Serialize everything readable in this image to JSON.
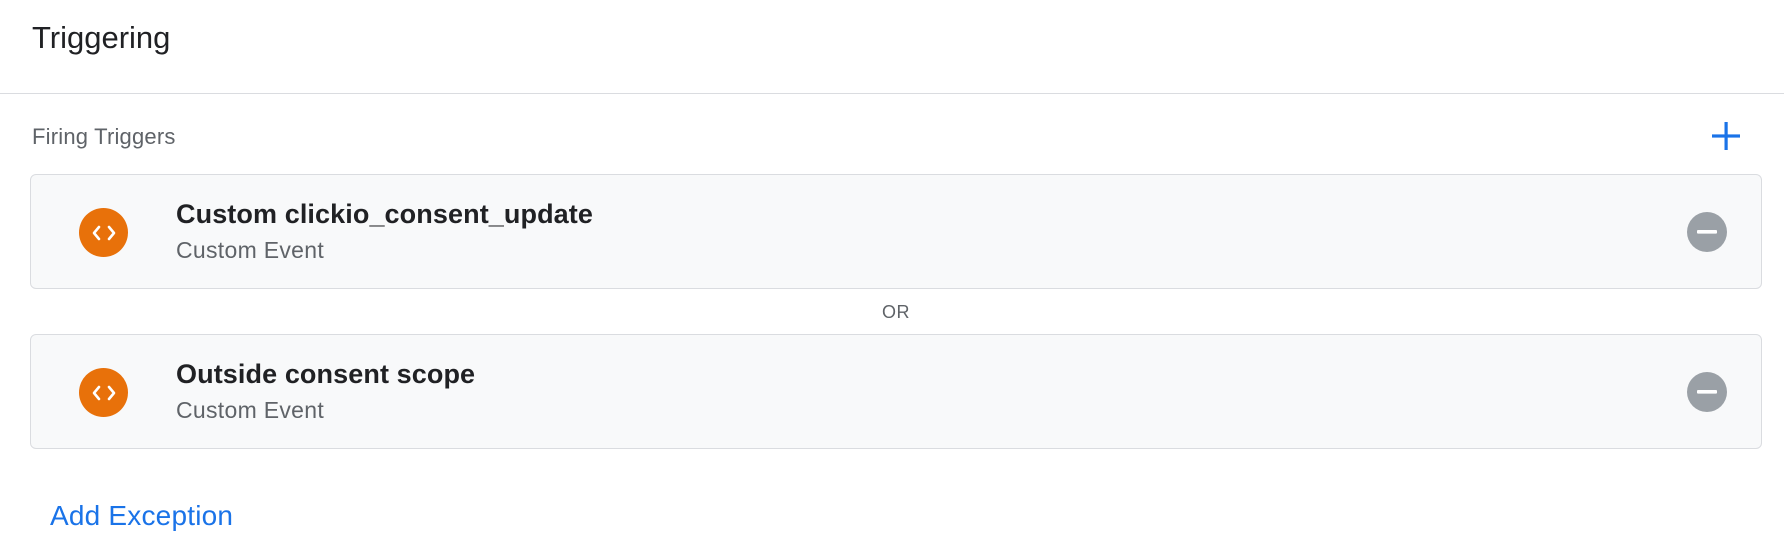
{
  "header": {
    "title": "Triggering"
  },
  "firing_triggers": {
    "label": "Firing Triggers",
    "add_icon": "plus-icon",
    "separator": "OR",
    "items": [
      {
        "name": "Custom clickio_consent_update",
        "type": "Custom Event",
        "icon": "code-brackets-icon",
        "remove_icon": "minus-circle-icon"
      },
      {
        "name": "Outside consent scope",
        "type": "Custom Event",
        "icon": "code-brackets-icon",
        "remove_icon": "minus-circle-icon"
      }
    ]
  },
  "exceptions": {
    "add_label": "Add Exception"
  },
  "colors": {
    "accent": "#1a73e8",
    "trigger_icon_bg": "#e8710a",
    "remove_icon_bg": "#9aa0a6",
    "card_bg": "#f8f9fa",
    "card_border": "#dadce0"
  }
}
